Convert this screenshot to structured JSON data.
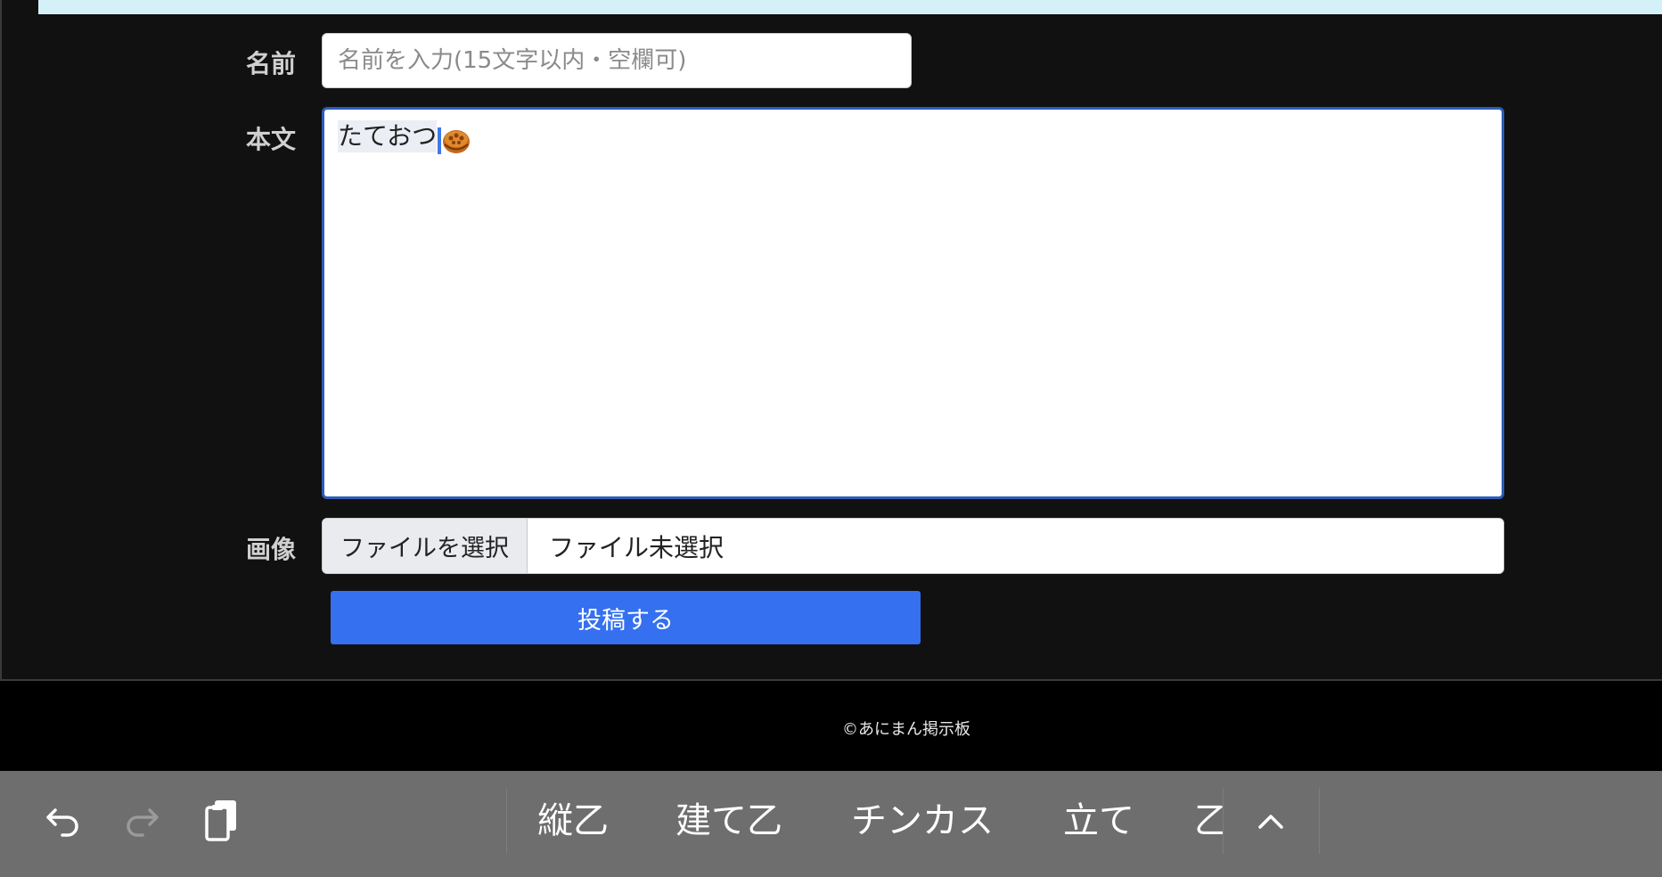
{
  "form": {
    "name_label": "名前",
    "name_placeholder": "名前を入力(15文字以内・空欄可)",
    "name_value": "",
    "body_label": "本文",
    "body_text": "たておつ",
    "body_emoji": "mooncake-icon",
    "image_label": "画像",
    "file_button": "ファイルを選択",
    "file_status": "ファイル未選択",
    "submit_label": "投稿する"
  },
  "footer": {
    "copyright": "©あにまん掲示板"
  },
  "keyboard": {
    "icons": [
      "undo-icon",
      "redo-icon",
      "clipboard-icon",
      "chevron-up-icon"
    ],
    "suggestions": [
      "縦乙",
      "建て乙",
      "チンカス",
      "立て",
      "乙"
    ]
  },
  "colors": {
    "accent": "#3470f0",
    "focus_border": "#2e5cb8",
    "panel_bg": "#111111",
    "top_bar": "#d4f1f9",
    "keyboard_bg": "#6e6e6e"
  }
}
